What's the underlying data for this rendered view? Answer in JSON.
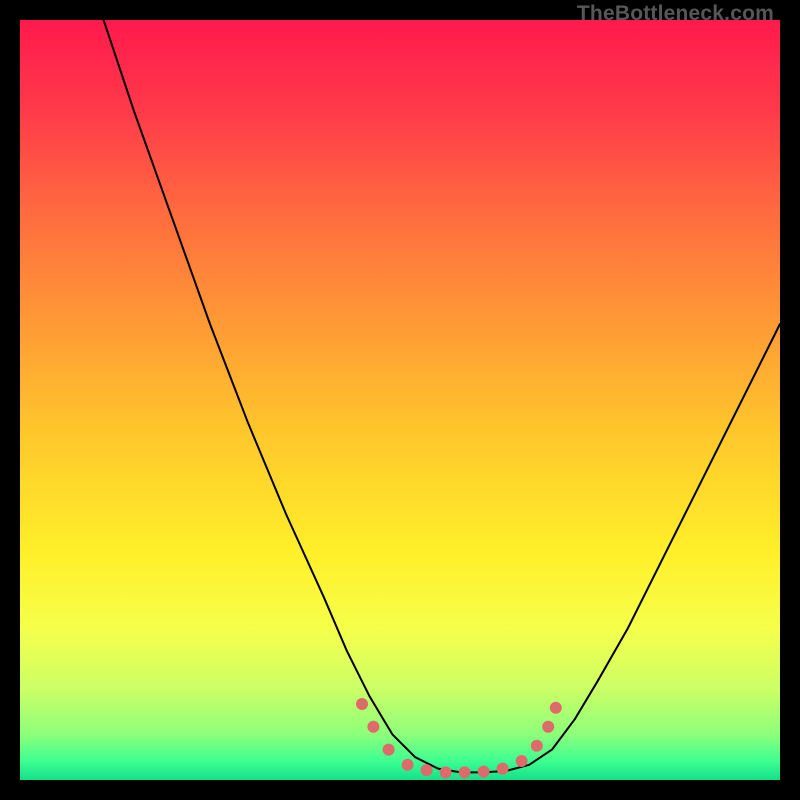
{
  "watermark": "TheBottleneck.com",
  "chart_data": {
    "type": "line",
    "title": "",
    "xlabel": "",
    "ylabel": "",
    "xlim": [
      0,
      100
    ],
    "ylim": [
      0,
      100
    ],
    "background_gradient": {
      "stops": [
        {
          "offset": 0.0,
          "color": "#ff1a4d"
        },
        {
          "offset": 0.12,
          "color": "#ff3a4a"
        },
        {
          "offset": 0.25,
          "color": "#ff6a3f"
        },
        {
          "offset": 0.4,
          "color": "#ff9a35"
        },
        {
          "offset": 0.55,
          "color": "#ffc92b"
        },
        {
          "offset": 0.7,
          "color": "#ffef2a"
        },
        {
          "offset": 0.8,
          "color": "#f6ff4a"
        },
        {
          "offset": 0.88,
          "color": "#ccff66"
        },
        {
          "offset": 0.94,
          "color": "#8dff7a"
        },
        {
          "offset": 0.975,
          "color": "#3dff91"
        },
        {
          "offset": 1.0,
          "color": "#14e08a"
        }
      ]
    },
    "series": [
      {
        "name": "bottleneck-curve",
        "color": "#000000",
        "stroke_width": 2,
        "x": [
          11,
          15,
          20,
          25,
          30,
          35,
          40,
          43,
          46,
          49,
          52,
          55,
          58,
          61,
          64,
          67,
          70,
          73,
          76,
          80,
          84,
          88,
          92,
          96,
          100
        ],
        "y": [
          100,
          88,
          74,
          60,
          47,
          35,
          24,
          17,
          11,
          6,
          3,
          1.5,
          1,
          1,
          1.2,
          2,
          4,
          8,
          13,
          20,
          28,
          36,
          44,
          52,
          60
        ]
      }
    ],
    "markers": {
      "name": "data-points",
      "color": "#dd6b6b",
      "radius": 6,
      "points": [
        {
          "x": 45.0,
          "y": 10.0
        },
        {
          "x": 46.5,
          "y": 7.0
        },
        {
          "x": 48.5,
          "y": 4.0
        },
        {
          "x": 51.0,
          "y": 2.0
        },
        {
          "x": 53.5,
          "y": 1.3
        },
        {
          "x": 56.0,
          "y": 1.0
        },
        {
          "x": 58.5,
          "y": 1.0
        },
        {
          "x": 61.0,
          "y": 1.1
        },
        {
          "x": 63.5,
          "y": 1.5
        },
        {
          "x": 66.0,
          "y": 2.5
        },
        {
          "x": 68.0,
          "y": 4.5
        },
        {
          "x": 69.5,
          "y": 7.0
        },
        {
          "x": 70.5,
          "y": 9.5
        }
      ]
    }
  }
}
